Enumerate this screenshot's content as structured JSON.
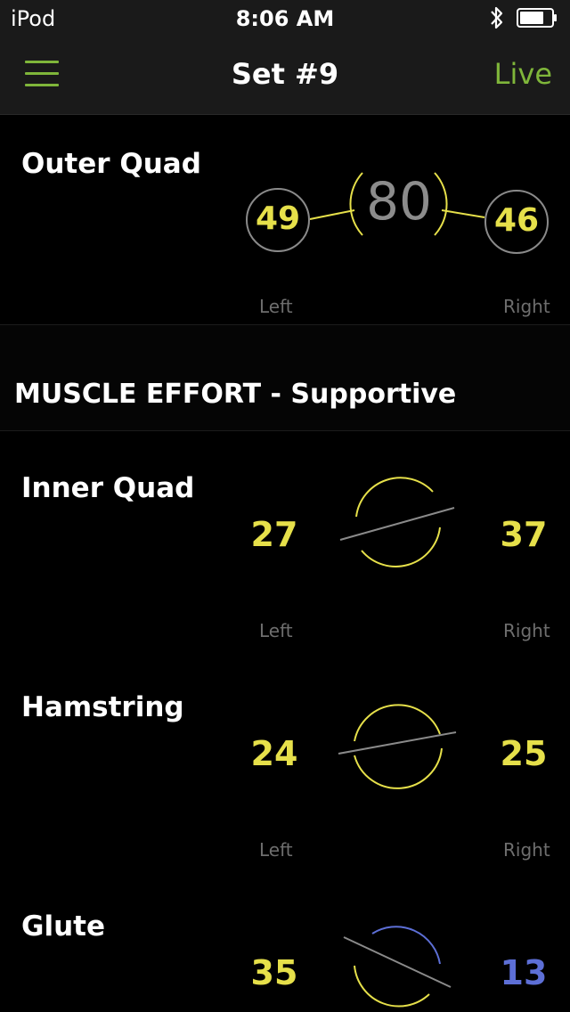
{
  "status_bar": {
    "carrier": "iPod",
    "time": "8:06 AM"
  },
  "nav": {
    "title": "Set #9",
    "live_label": "Live"
  },
  "outer_quad": {
    "label": "Outer Quad",
    "total": "80",
    "left_value": "49",
    "right_value": "46",
    "left_label": "Left",
    "right_label": "Right"
  },
  "section": {
    "title": "MUSCLE EFFORT - Supportive"
  },
  "muscles": [
    {
      "label": "Inner Quad",
      "left_value": "27",
      "right_value": "37",
      "left_label": "Left",
      "right_label": "Right",
      "tilt_deg": -14
    },
    {
      "label": "Hamstring",
      "left_value": "24",
      "right_value": "25",
      "left_label": "Left",
      "right_label": "Right",
      "tilt_deg": -8
    },
    {
      "label": "Glute",
      "left_value": "35",
      "right_value": "13",
      "tilt_deg": 28
    }
  ],
  "colors": {
    "accent_green": "#7fb63a",
    "value_yellow": "#e6e04a",
    "value_blue": "#5d6fd6",
    "label_grey": "#6e6e6e"
  },
  "icons": {
    "menu": "hamburger-icon",
    "bluetooth": "bluetooth-icon",
    "battery": "battery-icon"
  }
}
